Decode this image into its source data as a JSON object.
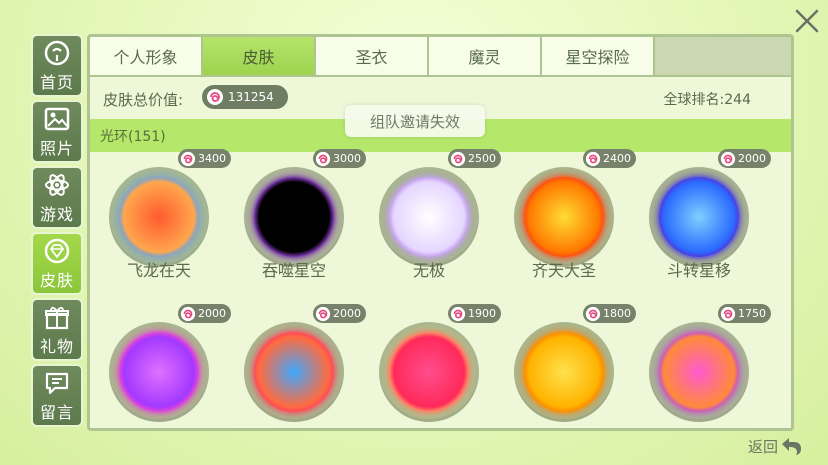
{
  "topbar": {
    "ghost_text": ""
  },
  "sidenav": [
    {
      "label": "首页",
      "icon": "face-icon"
    },
    {
      "label": "照片",
      "icon": "photo-icon"
    },
    {
      "label": "游戏",
      "icon": "atom-icon"
    },
    {
      "label": "皮肤",
      "icon": "diamond-icon",
      "active": true
    },
    {
      "label": "礼物",
      "icon": "gift-icon"
    },
    {
      "label": "留言",
      "icon": "message-icon"
    }
  ],
  "tabs": [
    {
      "label": "个人形象"
    },
    {
      "label": "皮肤",
      "active": true
    },
    {
      "label": "圣衣"
    },
    {
      "label": "魔灵"
    },
    {
      "label": "星空探险"
    }
  ],
  "skin_value": {
    "label": "皮肤总价值:",
    "amount": "131254"
  },
  "ranking": "全球排名:244",
  "toast": "组队邀请失效",
  "category": "光环(151)",
  "items": [
    {
      "name": "飞龙在天",
      "price": "3400",
      "colors": [
        "#ff5a2e",
        "#ffa64d",
        "#4aa2ff"
      ]
    },
    {
      "name": "吞噬星空",
      "price": "3000",
      "colors": [
        "#000000",
        "#000000",
        "#b24dff"
      ]
    },
    {
      "name": "无极",
      "price": "2500",
      "colors": [
        "#ffffff",
        "#e6d6ff",
        "#b58be6"
      ]
    },
    {
      "name": "齐天大圣",
      "price": "2400",
      "colors": [
        "#ffdd33",
        "#ff7a00",
        "#ff3a1a"
      ]
    },
    {
      "name": "斗转星移",
      "price": "2000",
      "colors": [
        "#7fd0ff",
        "#2b6bff",
        "#5a2bd6"
      ]
    },
    {
      "name": "",
      "price": "2000",
      "colors": [
        "#e071ff",
        "#a338ff",
        "#ff4dc4"
      ]
    },
    {
      "name": "",
      "price": "2000",
      "colors": [
        "#3fa7ff",
        "#ff6b3f",
        "#ff3b6b"
      ]
    },
    {
      "name": "",
      "price": "1900",
      "colors": [
        "#ff4d8d",
        "#ff2a5a",
        "#ffb36a"
      ]
    },
    {
      "name": "",
      "price": "1800",
      "colors": [
        "#ffe14d",
        "#ffb300",
        "#ff7a00"
      ]
    },
    {
      "name": "",
      "price": "1750",
      "colors": [
        "#ff5ad0",
        "#ff8a3a",
        "#b044ff"
      ]
    }
  ],
  "back_label": "返回"
}
